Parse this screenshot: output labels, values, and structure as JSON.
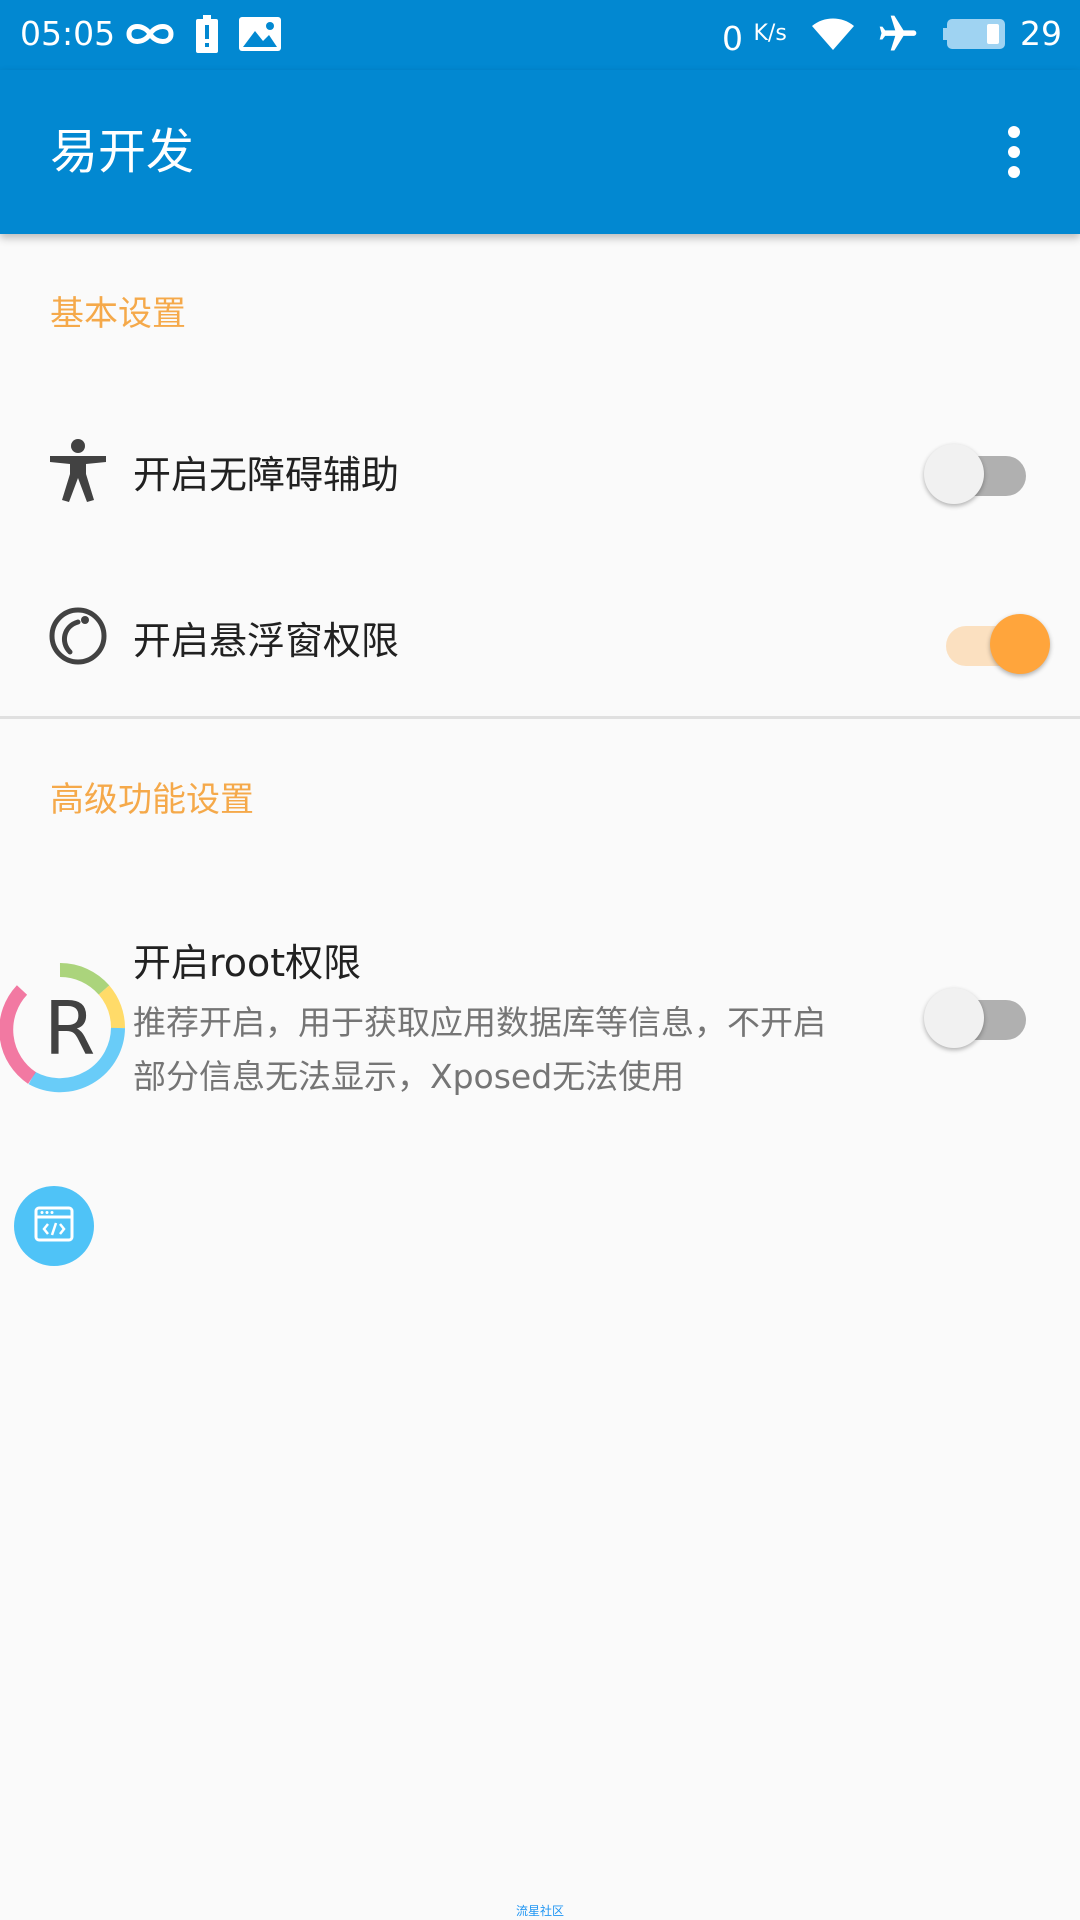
{
  "status_bar": {
    "time": "05:05",
    "net_speed_value": "0",
    "net_speed_unit": "K/s",
    "battery_level": "29",
    "icons": [
      "infinity-icon",
      "battery-alert-icon",
      "image-icon",
      "wifi-icon",
      "airplane-icon",
      "battery-icon"
    ]
  },
  "app_bar": {
    "title": "易开发",
    "menu_icon": "more-vert-icon"
  },
  "sections": {
    "basic": {
      "header": "基本设置",
      "accessibility": {
        "title": "开启无障碍辅助",
        "icon": "accessibility-icon",
        "enabled": false
      },
      "overlay": {
        "title": "开启悬浮窗权限",
        "icon": "overlay-icon",
        "enabled": true
      }
    },
    "advanced": {
      "header": "高级功能设置",
      "root": {
        "title": "开启root权限",
        "summary_line1": "推荐开启，用于获取应用数据库等信息，不开启",
        "summary_line2": "部分信息无法显示，Xposed无法使用",
        "enabled": false
      }
    }
  },
  "floating": {
    "badge_letter": "R",
    "button_icon": "code-window-icon"
  },
  "watermark": "流星社区",
  "colors": {
    "primary": "#0288d1",
    "accent": "#ffa53c",
    "section_header": "#f5a94a",
    "float_button": "#4fc3f7"
  }
}
